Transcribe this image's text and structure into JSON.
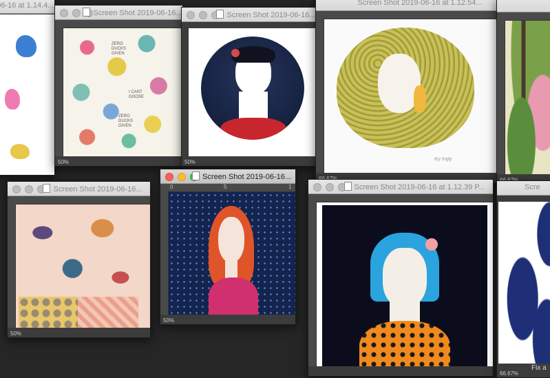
{
  "windows": [
    {
      "id": "w1",
      "title": "-06-16 at 1.14.4...",
      "zoom": ""
    },
    {
      "id": "w2",
      "title": "Screen Shot 2019-06-16...",
      "zoom": "50%"
    },
    {
      "id": "w3",
      "title": "Screen Shot 2019-06-16...",
      "zoom": "50%"
    },
    {
      "id": "w4",
      "title": "Screen Shot 2019-06-16 at 1.12.54...",
      "zoom": "66.67%"
    },
    {
      "id": "w5",
      "title": "",
      "zoom": "66.67%"
    },
    {
      "id": "w6",
      "title": "Screen Shot 2019-06-16...",
      "zoom": "50%"
    },
    {
      "id": "w7",
      "title": "Screen Shot 2019-06-16...",
      "zoom": "50%"
    },
    {
      "id": "w8",
      "title": "Screen Shot 2019-06-16 at 1.12.39 P...",
      "zoom": ""
    },
    {
      "id": "w9",
      "title": "Scre",
      "zoom": "66.67%"
    }
  ],
  "artwork": {
    "bird_pattern_text": [
      "ZERO DUCKS GIVEN",
      "I CANT GOOSE",
      "ZERO DUCKS GIVEN"
    ],
    "signature": "ley Ingly"
  },
  "bottom_right_text": "Fix a",
  "ruler_ticks": [
    "0",
    "5",
    "1",
    "1",
    "1"
  ]
}
